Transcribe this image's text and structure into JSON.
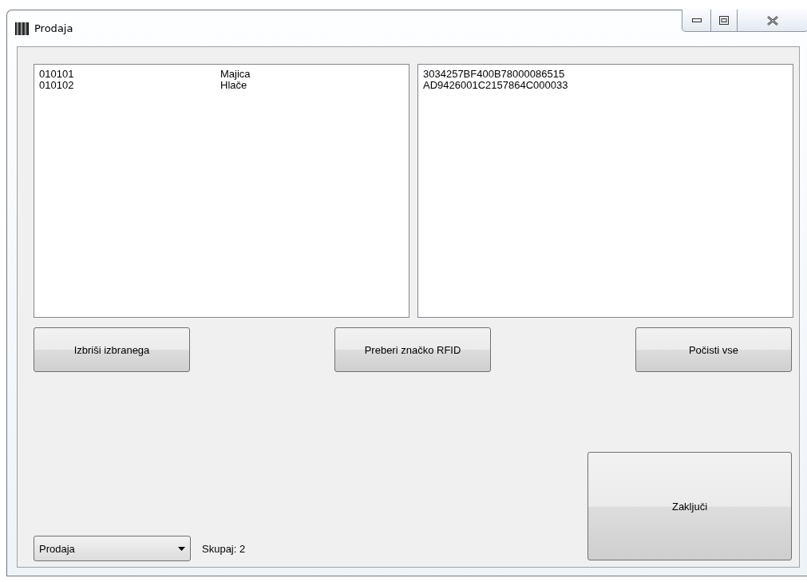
{
  "window": {
    "title": "Prodaja"
  },
  "items_list": [
    {
      "code": "010101",
      "name": "Majica"
    },
    {
      "code": "010102",
      "name": "Hlače"
    }
  ],
  "tags_list": [
    "3034257BF400B78000086515",
    "AD9426001C2157864C000033"
  ],
  "buttons": [
    "Izbriši izbranega",
    "Preberi značko RFID",
    "Počisti vse"
  ],
  "mode_select": {
    "value": "Prodaja"
  },
  "total_label": "Skupaj: 2",
  "finish_button": "Zaključi"
}
